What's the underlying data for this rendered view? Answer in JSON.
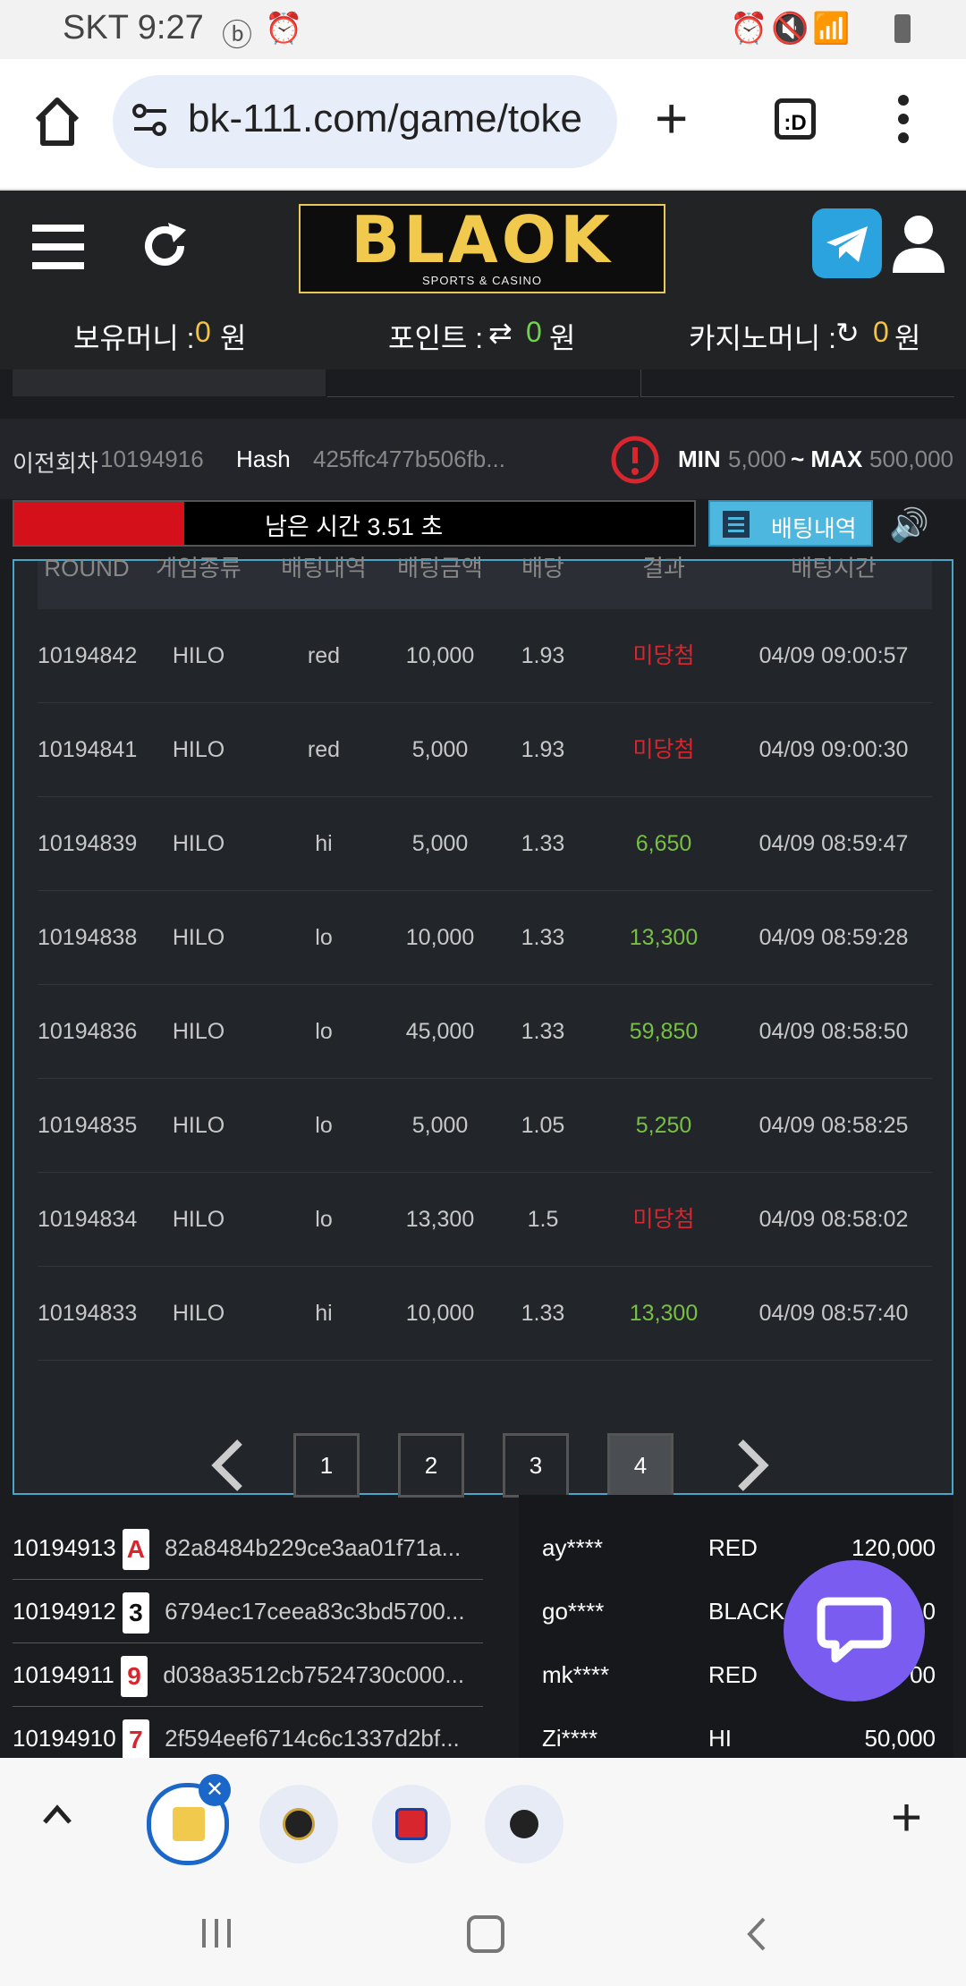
{
  "status_bar": {
    "carrier_time": "SKT 9:27"
  },
  "browser": {
    "url": "bk-111.com/game/toke",
    "tab_count_label": ":D"
  },
  "header": {
    "logo_main": "BLAOK",
    "logo_sub": "SPORTS & CASINO",
    "balance_label": "보유머니 :",
    "balance_value": "0",
    "currency": "원",
    "points_label": "포인트 :",
    "points_value": "0",
    "casino_label": "카지노머니 :",
    "casino_value": "0"
  },
  "round_info": {
    "prev_label": "이전회차",
    "prev_value": "10194916",
    "hash_label": "Hash",
    "hash_value": "425ffc477b506fb...",
    "min_label": "MIN",
    "min_value": "5,000",
    "max_label": "~ MAX",
    "max_value": "500,000"
  },
  "timer": {
    "text": "남은 시간 3.51 초",
    "remaining_fraction": 0.25
  },
  "bet_history_button": "배팅내역",
  "table": {
    "headers": [
      "ROUND",
      "게임종류",
      "배팅내역",
      "배팅금액",
      "배당",
      "결과",
      "배팅시간"
    ],
    "rows": [
      {
        "round": "10194842",
        "game": "HILO",
        "bet": "red",
        "amount": "10,000",
        "odds": "1.93",
        "result": "미당첨",
        "win": false,
        "time": "04/09 09:00:57"
      },
      {
        "round": "10194841",
        "game": "HILO",
        "bet": "red",
        "amount": "5,000",
        "odds": "1.93",
        "result": "미당첨",
        "win": false,
        "time": "04/09 09:00:30"
      },
      {
        "round": "10194839",
        "game": "HILO",
        "bet": "hi",
        "amount": "5,000",
        "odds": "1.33",
        "result": "6,650",
        "win": true,
        "time": "04/09 08:59:47"
      },
      {
        "round": "10194838",
        "game": "HILO",
        "bet": "lo",
        "amount": "10,000",
        "odds": "1.33",
        "result": "13,300",
        "win": true,
        "time": "04/09 08:59:28"
      },
      {
        "round": "10194836",
        "game": "HILO",
        "bet": "lo",
        "amount": "45,000",
        "odds": "1.33",
        "result": "59,850",
        "win": true,
        "time": "04/09 08:58:50"
      },
      {
        "round": "10194835",
        "game": "HILO",
        "bet": "lo",
        "amount": "5,000",
        "odds": "1.05",
        "result": "5,250",
        "win": true,
        "time": "04/09 08:58:25"
      },
      {
        "round": "10194834",
        "game": "HILO",
        "bet": "lo",
        "amount": "13,300",
        "odds": "1.5",
        "result": "미당첨",
        "win": false,
        "time": "04/09 08:58:02"
      },
      {
        "round": "10194833",
        "game": "HILO",
        "bet": "hi",
        "amount": "10,000",
        "odds": "1.33",
        "result": "13,300",
        "win": true,
        "time": "04/09 08:57:40"
      }
    ]
  },
  "pagination": {
    "pages": [
      "1",
      "2",
      "3",
      "4"
    ],
    "active": "4"
  },
  "recent_rounds": [
    {
      "round": "10194913",
      "card": "A",
      "suit": "♦",
      "hash": "82a8484b229ce3aa01f71a..."
    },
    {
      "round": "10194912",
      "card": "3",
      "suit": "♣",
      "hash": "6794ec17ceea83c3bd5700..."
    },
    {
      "round": "10194911",
      "card": "9",
      "suit": "♥",
      "hash": "d038a3512cb7524730c000..."
    },
    {
      "round": "10194910",
      "card": "7",
      "suit": "♦",
      "hash": "2f594eef6714c6c1337d2bf..."
    }
  ],
  "live_bets": [
    {
      "user": "ay****",
      "pick": "RED",
      "amount": "120,000"
    },
    {
      "user": "go****",
      "pick": "BLACK",
      "amount": "0"
    },
    {
      "user": "mk****",
      "pick": "RED",
      "amount": "00"
    },
    {
      "user": "Zi****",
      "pick": "HI",
      "amount": "50,000"
    }
  ],
  "colors": {
    "accent": "#4aa6c9",
    "loss": "#d8262e",
    "win": "#77c043",
    "gold": "#f1c94c",
    "chat": "#7b5cf0"
  }
}
